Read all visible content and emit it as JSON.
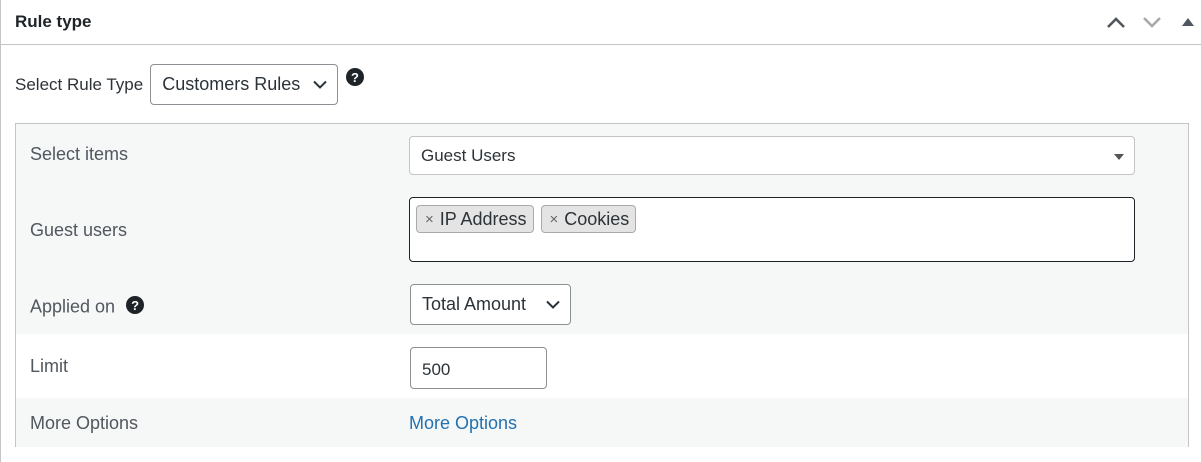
{
  "panel": {
    "title": "Rule type",
    "move_up_icon": "chevron-up-icon",
    "move_down_icon": "chevron-down-icon",
    "toggle_icon": "triangle-up-icon"
  },
  "rule_type": {
    "label": "Select Rule Type",
    "selected": "Customers Rules",
    "help": "?"
  },
  "rows": {
    "select_items": {
      "label": "Select items",
      "selected": "Guest Users"
    },
    "guest_users": {
      "label": "Guest users",
      "tags": [
        "IP Address",
        "Cookies"
      ],
      "remove_glyph": "×"
    },
    "applied_on": {
      "label": "Applied on",
      "help": "?",
      "selected": "Total Amount"
    },
    "limit": {
      "label": "Limit",
      "value": "500"
    },
    "more_options": {
      "label": "More Options",
      "link": "More Options"
    }
  },
  "colors": {
    "link": "#2271b1",
    "row_grey": "#f6f7f7",
    "border": "#c3c4c7"
  }
}
